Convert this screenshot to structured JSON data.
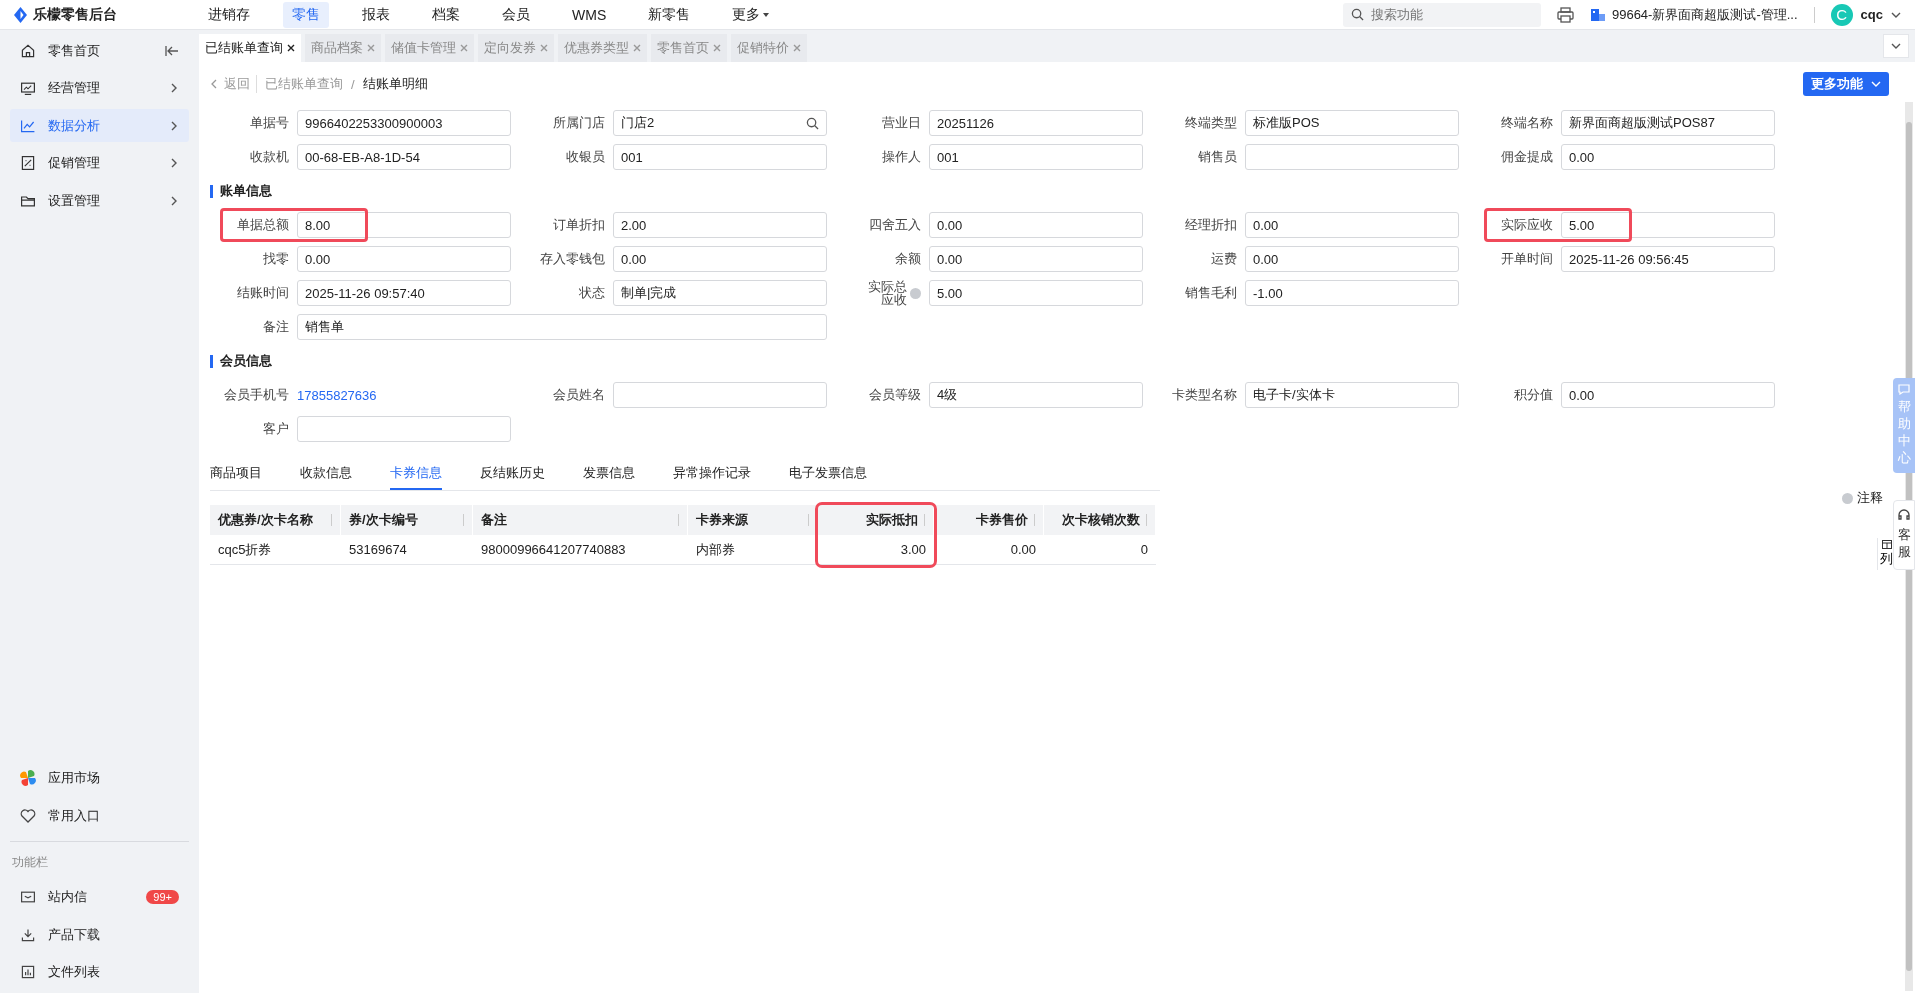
{
  "brand": {
    "name": "乐檬零售后台"
  },
  "top_nav": [
    {
      "label": "进销存",
      "selected": false,
      "kind": "link"
    },
    {
      "label": "零售",
      "selected": true,
      "kind": "link"
    },
    {
      "label": "报表",
      "selected": false,
      "kind": "link"
    },
    {
      "label": "档案",
      "selected": false,
      "kind": "link"
    },
    {
      "label": "会员",
      "selected": false,
      "kind": "link"
    },
    {
      "label": "WMS",
      "selected": false,
      "kind": "link"
    },
    {
      "label": "新零售",
      "selected": false,
      "kind": "link"
    },
    {
      "label": "更多",
      "selected": false,
      "kind": "menu"
    }
  ],
  "search": {
    "placeholder": "搜索功能"
  },
  "store": {
    "label": "99664-新界面商超版测试-管理..."
  },
  "user": {
    "initial": "C",
    "name": "cqc"
  },
  "sidebar": {
    "items": [
      {
        "label": "零售首页",
        "selected": false,
        "kind": "collapse"
      },
      {
        "label": "经营管理",
        "selected": false,
        "kind": "expand"
      },
      {
        "label": "数据分析",
        "selected": true,
        "kind": "expand"
      },
      {
        "label": "促销管理",
        "selected": false,
        "kind": "expand"
      },
      {
        "label": "设置管理",
        "selected": false,
        "kind": "expand"
      }
    ],
    "bottom_items": [
      {
        "label": "应用市场"
      },
      {
        "label": "常用入口"
      }
    ],
    "section_label": "功能栏",
    "tool_items": [
      {
        "label": "站内信",
        "badge": "99+"
      },
      {
        "label": "产品下载"
      },
      {
        "label": "文件列表"
      }
    ]
  },
  "tabs": [
    {
      "label": "已结账单查询",
      "selected": true
    },
    {
      "label": "商品档案",
      "selected": false
    },
    {
      "label": "储值卡管理",
      "selected": false
    },
    {
      "label": "定向发券",
      "selected": false
    },
    {
      "label": "优惠券类型",
      "selected": false
    },
    {
      "label": "零售首页",
      "selected": false
    },
    {
      "label": "促销特价",
      "selected": false
    }
  ],
  "breadcrumb": {
    "back": "返回",
    "items": [
      "已结账单查询",
      "结账单明细"
    ],
    "separator": "/"
  },
  "more_button": {
    "label": "更多功能"
  },
  "header": {
    "rows": [
      [
        {
          "label": "单据号",
          "value": "9966402253300900003",
          "kind": "input",
          "highlighted": false
        },
        {
          "label": "所属门店",
          "value": "门店2",
          "kind": "search",
          "highlighted": false
        },
        {
          "label": "营业日",
          "value": "20251126",
          "kind": "input",
          "highlighted": false
        },
        {
          "label": "终端类型",
          "value": "标准版POS",
          "kind": "input",
          "highlighted": false
        },
        {
          "label": "终端名称",
          "value": "新界面商超版测试POS87",
          "kind": "input",
          "highlighted": false
        }
      ],
      [
        {
          "label": "收款机",
          "value": "00-68-EB-A8-1D-54",
          "kind": "input",
          "highlighted": false
        },
        {
          "label": "收银员",
          "value": "001",
          "kind": "input",
          "highlighted": false
        },
        {
          "label": "操作人",
          "value": "001",
          "kind": "input",
          "highlighted": false
        },
        {
          "label": "销售员",
          "kind": "input",
          "highlighted": false
        },
        {
          "label": "佣金提成",
          "value": "0.00",
          "kind": "input",
          "highlighted": false
        }
      ]
    ]
  },
  "sections": [
    {
      "title": "账单信息",
      "rows": [
        [
          {
            "label": "单据总额",
            "value": "8.00",
            "kind": "input",
            "highlighted": true
          },
          {
            "label": "订单折扣",
            "value": "2.00",
            "kind": "input",
            "highlighted": false
          },
          {
            "label": "四舍五入",
            "value": "0.00",
            "kind": "input",
            "highlighted": false
          },
          {
            "label": "经理折扣",
            "value": "0.00",
            "kind": "input",
            "highlighted": false
          },
          {
            "label": "实际应收",
            "value": "5.00",
            "kind": "input",
            "highlighted": true
          }
        ],
        [
          {
            "label": "找零",
            "value": "0.00",
            "kind": "input",
            "highlighted": false
          },
          {
            "label": "存入零钱包",
            "value": "0.00",
            "kind": "input",
            "highlighted": false
          },
          {
            "label": "余额",
            "value": "0.00",
            "kind": "input",
            "highlighted": false
          },
          {
            "label": "运费",
            "value": "0.00",
            "kind": "input",
            "highlighted": false
          },
          {
            "label": "开单时间",
            "value": "2025-11-26 09:56:45",
            "kind": "input",
            "highlighted": false
          }
        ],
        [
          {
            "label": "结账时间",
            "value": "2025-11-26 09:57:40",
            "kind": "input",
            "highlighted": false
          },
          {
            "label": "状态",
            "value": "制单|完成",
            "kind": "input",
            "highlighted": false
          },
          {
            "label": "实际总应收",
            "value": "5.00",
            "kind": "help",
            "highlighted": false
          },
          {
            "label": "销售毛利",
            "value": "-1.00",
            "kind": "input",
            "highlighted": false
          }
        ],
        [
          {
            "label": "备注",
            "value": "销售单",
            "kind": "wide",
            "highlighted": false
          }
        ]
      ]
    },
    {
      "title": "会员信息",
      "rows": [
        [
          {
            "label": "会员手机号",
            "value": "17855827636",
            "kind": "link",
            "highlighted": false
          },
          {
            "label": "会员姓名",
            "kind": "input",
            "highlighted": false
          },
          {
            "label": "会员等级",
            "value": "4级",
            "kind": "input",
            "highlighted": false
          },
          {
            "label": "卡类型名称",
            "value": "电子卡/实体卡",
            "kind": "input",
            "highlighted": false
          },
          {
            "label": "积分值",
            "value": "0.00",
            "kind": "input",
            "highlighted": false
          }
        ],
        [
          {
            "label": "客户",
            "kind": "input",
            "highlighted": false
          }
        ]
      ]
    }
  ],
  "detail_tabs": [
    {
      "label": "商品项目",
      "selected": false
    },
    {
      "label": "收款信息",
      "selected": false
    },
    {
      "label": "卡券信息",
      "selected": true
    },
    {
      "label": "反结账历史",
      "selected": false
    },
    {
      "label": "发票信息",
      "selected": false
    },
    {
      "label": "异常操作记录",
      "selected": false
    },
    {
      "label": "电子发票信息",
      "selected": false
    }
  ],
  "note_toggle": {
    "label": "注释"
  },
  "table": {
    "columns": [
      {
        "label": "优惠券/次卡名称",
        "kind": "text",
        "highlighted": false
      },
      {
        "label": "券/次卡编号",
        "kind": "text",
        "highlighted": false
      },
      {
        "label": "备注",
        "kind": "text",
        "highlighted": false
      },
      {
        "label": "卡券来源",
        "kind": "text",
        "highlighted": false
      },
      {
        "label": "实际抵扣",
        "kind": "number",
        "highlighted": true
      },
      {
        "label": "卡券售价",
        "kind": "number",
        "highlighted": false
      },
      {
        "label": "次卡核销次数",
        "kind": "number",
        "highlighted": false
      }
    ],
    "rows": [
      [
        "cqc5折券",
        "53169674",
        "98000996641207740883",
        "内部券",
        "3.00",
        "0.00",
        "0"
      ]
    ]
  },
  "column_settings": {
    "label": "列"
  },
  "help_float": {
    "label": "帮助中心"
  },
  "service_float": {
    "label": "客服"
  }
}
